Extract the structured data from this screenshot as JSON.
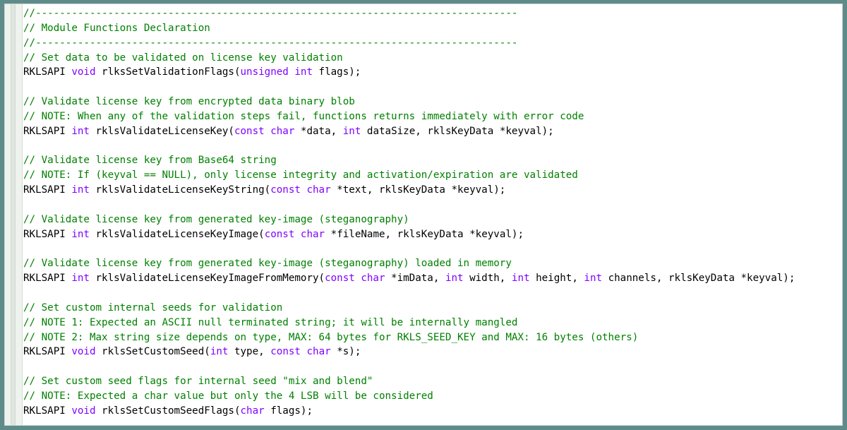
{
  "editor": {
    "lines": [
      [
        {
          "t": "//--------------------------------------------------------------------------------",
          "c": "cm"
        }
      ],
      [
        {
          "t": "// Module Functions Declaration",
          "c": "cm"
        }
      ],
      [
        {
          "t": "//--------------------------------------------------------------------------------",
          "c": "cm"
        }
      ],
      [
        {
          "t": "// Set data to be validated on license key validation",
          "c": "cm"
        }
      ],
      [
        {
          "t": "RKLSAPI ",
          "c": "tx"
        },
        {
          "t": "void",
          "c": "kw"
        },
        {
          "t": " rlksSetValidationFlags(",
          "c": "tx"
        },
        {
          "t": "unsigned int",
          "c": "kw"
        },
        {
          "t": " flags);",
          "c": "tx"
        }
      ],
      [],
      [
        {
          "t": "// Validate license key from encrypted data binary blob",
          "c": "cm"
        }
      ],
      [
        {
          "t": "// NOTE: When any of the validation steps fail, functions returns immediately with error code",
          "c": "cm"
        }
      ],
      [
        {
          "t": "RKLSAPI ",
          "c": "tx"
        },
        {
          "t": "int",
          "c": "kw"
        },
        {
          "t": " rklsValidateLicenseKey(",
          "c": "tx"
        },
        {
          "t": "const char",
          "c": "kw"
        },
        {
          "t": " *data, ",
          "c": "tx"
        },
        {
          "t": "int",
          "c": "kw"
        },
        {
          "t": " dataSize, rklsKeyData *keyval);",
          "c": "tx"
        }
      ],
      [],
      [
        {
          "t": "// Validate license key from Base64 string",
          "c": "cm"
        }
      ],
      [
        {
          "t": "// NOTE: If (keyval == NULL), only license integrity and activation/expiration are validated",
          "c": "cm"
        }
      ],
      [
        {
          "t": "RKLSAPI ",
          "c": "tx"
        },
        {
          "t": "int",
          "c": "kw"
        },
        {
          "t": " rklsValidateLicenseKeyString(",
          "c": "tx"
        },
        {
          "t": "const char",
          "c": "kw"
        },
        {
          "t": " *text, rklsKeyData *keyval);",
          "c": "tx"
        }
      ],
      [],
      [
        {
          "t": "// Validate license key from generated key-image (steganography)",
          "c": "cm"
        }
      ],
      [
        {
          "t": "RKLSAPI ",
          "c": "tx"
        },
        {
          "t": "int",
          "c": "kw"
        },
        {
          "t": " rklsValidateLicenseKeyImage(",
          "c": "tx"
        },
        {
          "t": "const char",
          "c": "kw"
        },
        {
          "t": " *fileName, rklsKeyData *keyval);",
          "c": "tx"
        }
      ],
      [],
      [
        {
          "t": "// Validate license key from generated key-image (steganography) loaded in memory",
          "c": "cm"
        }
      ],
      [
        {
          "t": "RKLSAPI ",
          "c": "tx"
        },
        {
          "t": "int",
          "c": "kw"
        },
        {
          "t": " rklsValidateLicenseKeyImageFromMemory(",
          "c": "tx"
        },
        {
          "t": "const char",
          "c": "kw"
        },
        {
          "t": " *imData, ",
          "c": "tx"
        },
        {
          "t": "int",
          "c": "kw"
        },
        {
          "t": " width, ",
          "c": "tx"
        },
        {
          "t": "int",
          "c": "kw"
        },
        {
          "t": " height, ",
          "c": "tx"
        },
        {
          "t": "int",
          "c": "kw"
        },
        {
          "t": " channels, rklsKeyData *keyval);",
          "c": "tx"
        }
      ],
      [],
      [
        {
          "t": "// Set custom internal seeds for validation",
          "c": "cm"
        }
      ],
      [
        {
          "t": "// NOTE 1: Expected an ASCII null terminated string; it will be internally mangled",
          "c": "cm"
        }
      ],
      [
        {
          "t": "// NOTE 2: Max string size depends on type, MAX: 64 bytes for RKLS_SEED_KEY and MAX: 16 bytes (others)",
          "c": "cm"
        }
      ],
      [
        {
          "t": "RKLSAPI ",
          "c": "tx"
        },
        {
          "t": "void",
          "c": "kw"
        },
        {
          "t": " rklsSetCustomSeed(",
          "c": "tx"
        },
        {
          "t": "int",
          "c": "kw"
        },
        {
          "t": " type, ",
          "c": "tx"
        },
        {
          "t": "const char",
          "c": "kw"
        },
        {
          "t": " *s);",
          "c": "tx"
        }
      ],
      [],
      [
        {
          "t": "// Set custom seed flags for internal seed \"mix and blend\"",
          "c": "cm"
        }
      ],
      [
        {
          "t": "// NOTE: Expected a char value but only the 4 LSB will be considered",
          "c": "cm"
        }
      ],
      [
        {
          "t": "RKLSAPI ",
          "c": "tx"
        },
        {
          "t": "void",
          "c": "kw"
        },
        {
          "t": " rklsSetCustomSeedFlags(",
          "c": "tx"
        },
        {
          "t": "char",
          "c": "kw"
        },
        {
          "t": " flags);",
          "c": "tx"
        }
      ]
    ]
  },
  "colors": {
    "comment": "#008000",
    "keyword": "#8000ff",
    "text": "#000000",
    "background": "#ffffff",
    "outer_frame": "#5f8c8a"
  }
}
